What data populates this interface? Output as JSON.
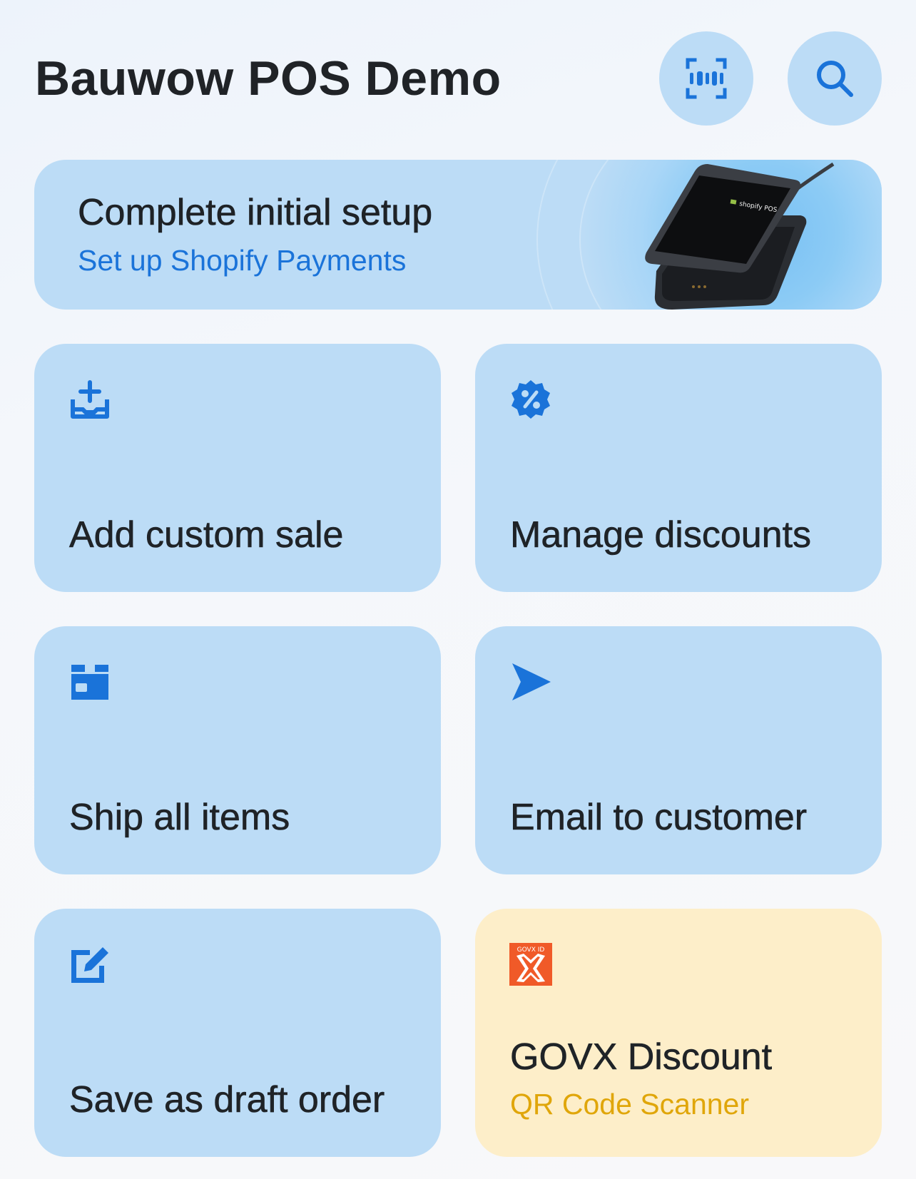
{
  "header": {
    "title": "Bauwow POS Demo",
    "scan_icon": "barcode-scan-icon",
    "search_icon": "search-icon"
  },
  "setup_banner": {
    "title": "Complete initial setup",
    "link": "Set up Shopify Payments",
    "device_screen_text": "shopify POS"
  },
  "tiles": [
    {
      "label": "Add custom sale",
      "icon": "tray-plus-icon"
    },
    {
      "label": "Manage discounts",
      "icon": "discount-badge-icon"
    },
    {
      "label": "Ship all items",
      "icon": "package-icon"
    },
    {
      "label": "Email to customer",
      "icon": "send-icon"
    },
    {
      "label": "Save as draft order",
      "icon": "edit-note-icon"
    },
    {
      "label": "GOVX Discount",
      "subtitle": "QR Code Scanner",
      "icon": "govx-id-logo-icon",
      "logo_text": "GOVX ID"
    }
  ],
  "colors": {
    "accent": "#1a73d9",
    "tile_bg": "#bcdcf6",
    "tile_yellow_bg": "#fdeec9",
    "subtitle_yellow": "#e0a60a",
    "govx_orange": "#f05a28"
  }
}
